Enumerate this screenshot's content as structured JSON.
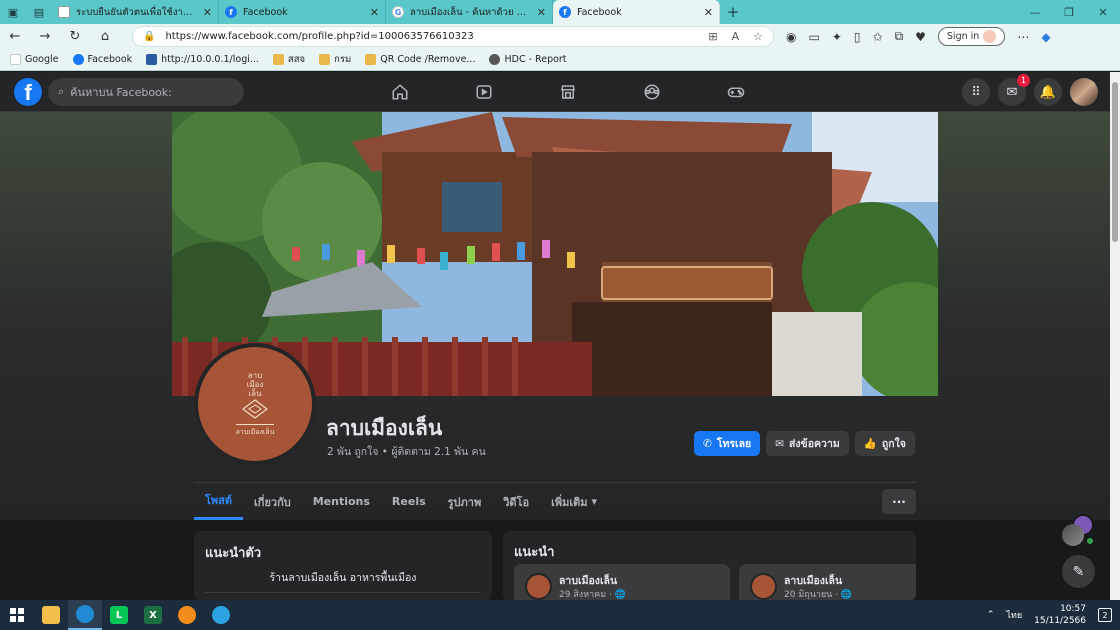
{
  "browser": {
    "tabs": [
      {
        "title": "ระบบยืนยันตัวตนเพื่อใช้งาน Internet",
        "favicon": "document-icon",
        "active": false
      },
      {
        "title": "Facebook",
        "favicon": "facebook-icon",
        "active": false
      },
      {
        "title": "ลาบเมืองเล็น - ค้นหาด้วย Google",
        "favicon": "google-icon",
        "active": false
      },
      {
        "title": "Facebook",
        "favicon": "facebook-icon",
        "active": true
      }
    ],
    "address": "https://www.facebook.com/profile.php?id=100063576610323",
    "signin_label": "Sign in",
    "bookmarks": [
      {
        "label": "Google",
        "icon": "google-icon"
      },
      {
        "label": "Facebook",
        "icon": "facebook-icon"
      },
      {
        "label": "http://10.0.0.1/logi...",
        "icon": "page-icon"
      },
      {
        "label": "สสจ",
        "icon": "folder-icon"
      },
      {
        "label": "กรม",
        "icon": "folder-icon"
      },
      {
        "label": "QR Code /Remove...",
        "icon": "folder-icon"
      },
      {
        "label": "HDC - Report",
        "icon": "hdc-icon"
      }
    ]
  },
  "facebook": {
    "search_placeholder": "ค้นหาบน Facebook:",
    "messenger_badge": "1",
    "page_name": "ลาบเมืองเล็น",
    "stats": "2 พัน ถูกใจ • ผู้ติดตาม 2.1 พัน คน",
    "avatar_text": [
      "ลาบ",
      "เมือง",
      "เล็น"
    ],
    "avatar_caption": "ลาบเมืองเล็น",
    "actions": {
      "call": "โทรเลย",
      "message": "ส่งข้อความ",
      "like": "ถูกใจ"
    },
    "tabs": [
      "โพสต์",
      "เกี่ยวกับ",
      "Mentions",
      "Reels",
      "รูปภาพ",
      "วิดีโอ",
      "เพิ่มเติม"
    ],
    "intro": {
      "title": "แนะนำตัว",
      "bio": "ร้านลาบเมืองเล็น อาหารพื้นเมือง"
    },
    "featured": {
      "title": "แนะนำ",
      "items": [
        {
          "title": "ลาบเมืองเล็น",
          "date": "29 สิงหาคม"
        },
        {
          "title": "ลาบเมืองเล็น",
          "date": "20 มิถุนายน"
        }
      ]
    }
  },
  "taskbar": {
    "language": "ไทย",
    "time": "10:57",
    "date": "15/11/2566"
  },
  "colors": {
    "accent": "#1877f2",
    "dark_bg": "#18191a",
    "card_bg": "#242526",
    "tab_bar": "#5ac8c8"
  }
}
